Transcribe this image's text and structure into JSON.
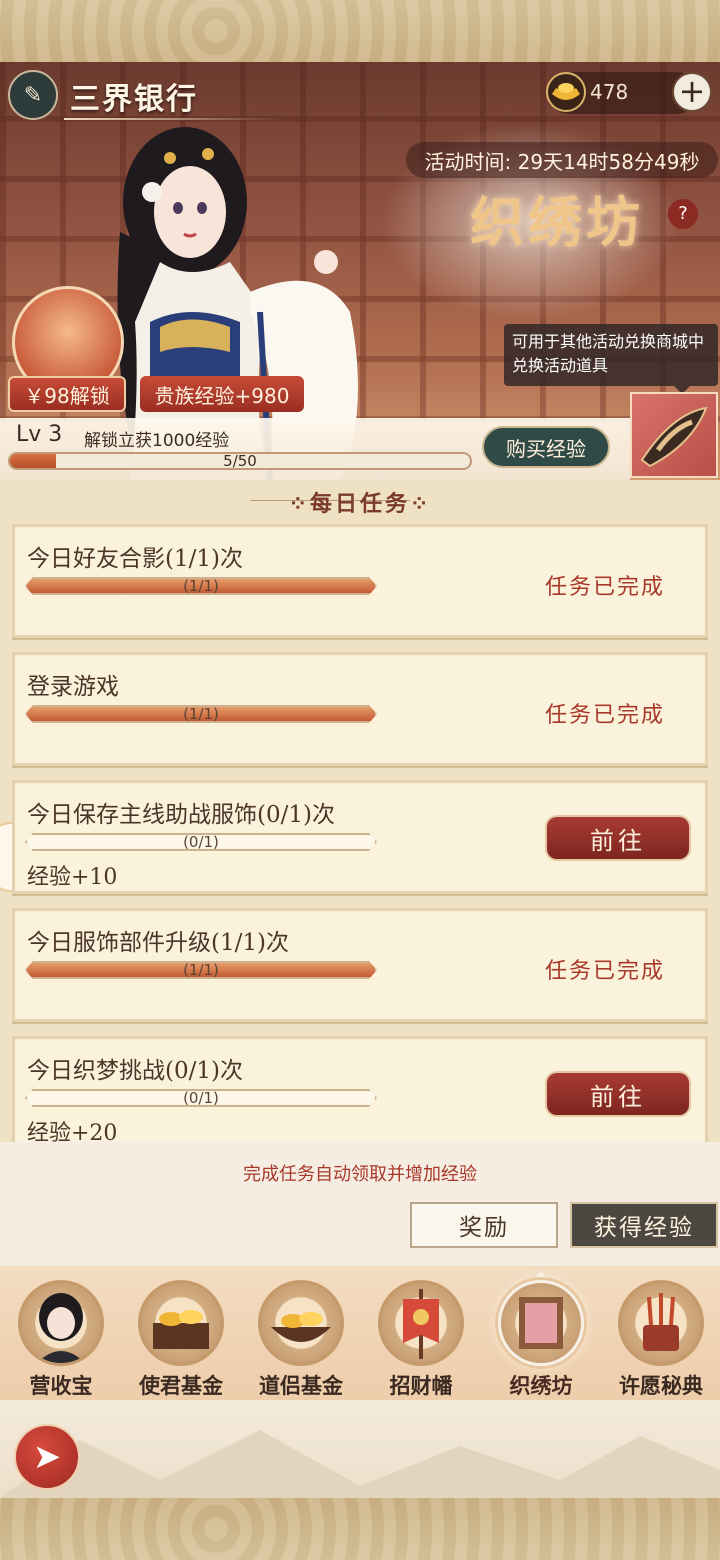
{
  "header": {
    "title": "三界银行",
    "currency_value": "478",
    "timer": "活动时间: 29天14时58分49秒",
    "event_name": "织绣坊",
    "help": "?",
    "unlock_label": "￥98解锁",
    "noble_exp_label": "贵族经验+980",
    "tooltip": "可用于其他活动兑换商城中兑换活动道具",
    "level_label": "Lv 3",
    "level_desc": "解锁立获1000经验",
    "buy_exp_label": "购买经验",
    "progress_text": "5/50",
    "progress_fraction": 0.1
  },
  "section_title": "⁘每日任务⁘",
  "tasks": [
    {
      "title": "今日好友合影(1/1)次",
      "progress_text": "(1/1)",
      "progress": 1.0,
      "status": "任务已完成"
    },
    {
      "title": "登录游戏",
      "progress_text": "(1/1)",
      "progress": 1.0,
      "status": "任务已完成"
    },
    {
      "title": "今日保存主线助战服饰(0/1)次",
      "progress_text": "(0/1)",
      "progress": 0.0,
      "action": "前往",
      "reward": "经验+10"
    },
    {
      "title": "今日服饰部件升级(1/1)次",
      "progress_text": "(1/1)",
      "progress": 1.0,
      "status": "任务已完成"
    },
    {
      "title": "今日织梦挑战(0/1)次",
      "progress_text": "(0/1)",
      "progress": 0.0,
      "action": "前往",
      "reward": "经验+20"
    }
  ],
  "bottom": {
    "auto_note": "完成任务自动领取并增加经验",
    "tab_reward": "奖励",
    "tab_exp": "获得经验"
  },
  "nav": [
    {
      "label": "营收宝",
      "icon": "portrait-icon"
    },
    {
      "label": "使君基金",
      "icon": "gold-chest-icon"
    },
    {
      "label": "道侣基金",
      "icon": "gold-bowl-icon"
    },
    {
      "label": "招财幡",
      "icon": "banner-flag-icon"
    },
    {
      "label": "织绣坊",
      "icon": "embroidery-frame-icon",
      "active": true
    },
    {
      "label": "许愿秘典",
      "icon": "incense-pot-icon"
    }
  ]
}
